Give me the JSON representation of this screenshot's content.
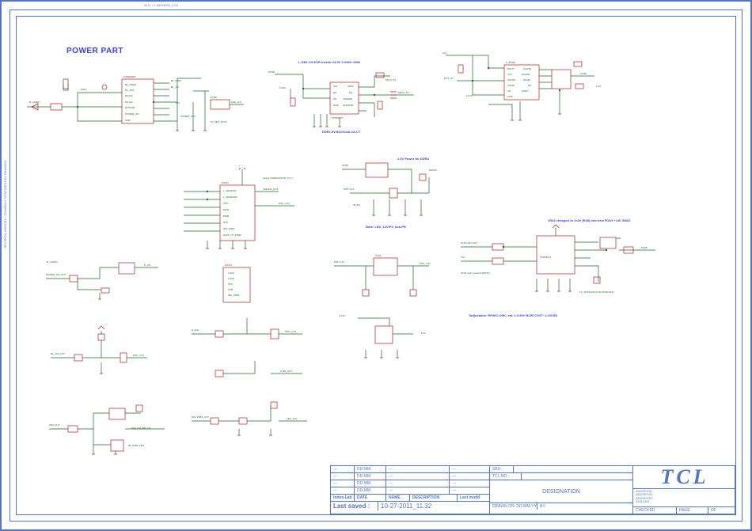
{
  "meta": {
    "topbar_note": "W.O. / 2.3M  MD00_2.03"
  },
  "section_title": "POWER PART",
  "blocks": {
    "A": {
      "ic_label": "U?POWER",
      "pins": [
        "BL_PWM1",
        "BL_ON1",
        "DC24V",
        "DC12V",
        "DC5VSB",
        "POWER_ON",
        "GND"
      ],
      "nets": [
        "J4_ACDET",
        "MAIN",
        "5VSB",
        "5V_DET_RT3V",
        "BL_ON",
        "4012_OFF",
        "POWER_OFF",
        "LED_12V"
      ]
    },
    "B": {
      "note_top": "L.DB1.CH.ESR trustor 24.5V 0.045K OHM",
      "ic_name": "TPS54327",
      "pins": [
        "VIN",
        "EN",
        "SS",
        "VBST",
        "PH",
        "VSENSE",
        "GND",
        "GND/PAD"
      ],
      "nets": [
        "5VSB",
        "DDR1_5V",
        "PGV1_5V",
        "LOCK"
      ],
      "note_bot": "DDR1.5V.BUCKout-1A.CT"
    },
    "C": {
      "ic_name": "U_5VSB",
      "pins": [
        "BOOT",
        "VCC",
        "CDATE",
        "COMP",
        "SG",
        "GND",
        "UGATE",
        "PHASE",
        "PGND",
        "FB",
        "SHDN"
      ],
      "nets": [
        "5VSB",
        "12V",
        "POV_5V",
        "LOCK",
        "1.2V"
      ]
    },
    "D": {
      "header": "PCON",
      "note": "output THERMISTOR_TO_U",
      "pins_left": [
        "L_SENSOR",
        "L_SENSOR2",
        "OPD",
        "DIM1",
        "DIM0",
        "NTC",
        "200_PWM",
        "DATA_CS_PWM"
      ],
      "nets": [
        "LSENS1_OUT",
        "MTK_3.3V"
      ]
    },
    "E": {
      "nets": [
        "J4_ACDET",
        "POWER_ON_OUT",
        "J2_ACDET",
        "P_ON"
      ]
    },
    "F": {
      "nets": [
        "BL_ON_OUT",
        "MTK_3.3V"
      ]
    },
    "G": {
      "nets": [
        "DIM_OUT",
        "DIM_OM_800_DC",
        "BL_PWM_DET"
      ]
    },
    "H": {
      "header": "PCON",
      "pins": [
        "LOCK",
        "LOCK",
        "NTC",
        "STB",
        "200_PWM",
        "..."
      ],
      "nets": [
        "8_ALE",
        "MTK_3.3V",
        "U.BD_OUT",
        "LED_12V",
        "200_PWM_OUT"
      ]
    },
    "I": {
      "note_top": "1.0V Power for DDR3",
      "nets": [
        "5VSB",
        "MTK 3.3V",
        "DDR3V",
        "IN_EN"
      ],
      "note_bot": "Note: LED_12V/P4_sub-PR"
    },
    "J": {
      "nets": [
        "MTK 3.3V",
        "MTK_3.3V",
        "U104",
        "LOCK",
        "1.2V"
      ]
    },
    "K": {
      "ic_name": "TPS54327",
      "note_top": "1R24 changed to 2n2k (R48) into new FDA3 +140 GND2",
      "nets": [
        "ON12 50V OUT",
        "12V",
        "12V8 main power(4-PR)/5V",
        "5VSB",
        "VDR",
        "1V_ADJ/SHUNT-12V RGB-R127"
      ],
      "note_bot1": "Tadjustable: RP46C=20K; saf. 1-0.99V\nBOM  COST: 1.20USD"
    }
  },
  "titleblock": {
    "logo": "TCL",
    "sbu_label": "SBU :",
    "sbu_value": "",
    "tclno_label": "TCL.NO.:",
    "tclno_value": "",
    "designation_label": "DESIGNATION",
    "designation_value": "",
    "addr": [
      "ADDRESS1",
      "ADDRESS2",
      "ADDRESS3",
      "33312441"
    ],
    "drawn_label": "DRAWN ON:",
    "drawn_value": "DD-MM-YY",
    "by_label": "BY:",
    "by_value": "",
    "checked_label": "CHECKED",
    "page_label": "PAGE:",
    "page_of": "OF",
    "revrows": [
      {
        "c0": "---",
        "c1": "DD-MM",
        "c2": "---",
        "c3": "---"
      },
      {
        "c0": "---",
        "c1": "DD-MM",
        "c2": "---",
        "c3": "---"
      },
      {
        "c0": "---",
        "c1": "DD-MM",
        "c2": "---",
        "c3": "---"
      },
      {
        "c0": "---",
        "c1": "DD-MM",
        "c2": "---",
        "c3": "---"
      }
    ],
    "revheader": {
      "c0": "Index-Lab",
      "c1": "DATE",
      "c2": "NAME",
      "c3": "DESCRIPTION",
      "c4": "Last modif"
    },
    "lastsaved_label": "Last saved :",
    "lastsaved_value": "10-27-2011_11.32"
  }
}
